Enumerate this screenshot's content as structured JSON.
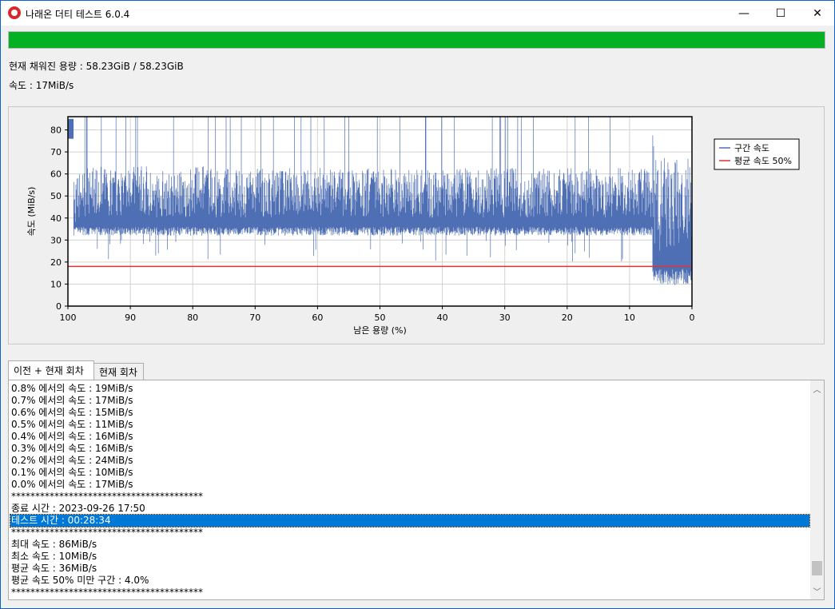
{
  "window": {
    "title": "나래온 더티 테스트 6.0.4",
    "minimize_glyph": "—",
    "maximize_glyph": "☐",
    "close_glyph": "✕"
  },
  "progress": {
    "percent": 100,
    "color": "#06b025"
  },
  "capacity_text": "현재 채워진 용량 : 58.23GiB / 58.23GiB",
  "speed_text": "속도 : 17MiB/s",
  "chart_data": {
    "type": "line",
    "xlabel": "남은 용량 (%)",
    "ylabel": "속도 (MiB/s)",
    "xlim": [
      100,
      0
    ],
    "ylim": [
      0,
      86
    ],
    "x_ticks": [
      "100",
      "90",
      "80",
      "70",
      "60",
      "50",
      "40",
      "30",
      "20",
      "10",
      "0"
    ],
    "y_ticks": [
      "0",
      "10",
      "20",
      "30",
      "40",
      "50",
      "60",
      "70",
      "80"
    ],
    "grid": true,
    "legend_position": "top-right",
    "series": [
      {
        "name": "구간 속도",
        "color": "#4f6fb5",
        "description": "dense interval speed trace",
        "x": [
          100,
          99.5,
          99.1,
          98,
          96,
          94,
          92,
          90,
          88,
          86,
          84,
          82,
          80,
          78,
          76,
          74,
          72,
          70,
          68,
          66,
          64,
          62,
          60,
          58,
          56,
          54,
          52,
          50,
          48,
          46,
          44,
          42,
          40,
          38,
          36,
          34,
          32,
          30,
          28,
          26,
          24,
          22,
          20,
          18,
          16,
          14,
          12,
          10,
          8,
          6.5,
          6,
          5,
          4,
          3,
          2,
          1,
          0
        ],
        "y": [
          80,
          82,
          38,
          42,
          44,
          43,
          42,
          43,
          44,
          42,
          43,
          42,
          43,
          44,
          42,
          43,
          42,
          43,
          42,
          43,
          44,
          42,
          43,
          42,
          43,
          42,
          43,
          42,
          43,
          42,
          43,
          42,
          43,
          42,
          43,
          42,
          43,
          42,
          43,
          42,
          43,
          42,
          43,
          42,
          43,
          42,
          43,
          42,
          43,
          42,
          25,
          22,
          24,
          20,
          26,
          22,
          25
        ]
      },
      {
        "name": "평균 속도 50%",
        "color": "#e03030",
        "x": [
          100,
          0
        ],
        "y": [
          18,
          18
        ]
      }
    ]
  },
  "tabs": [
    "이전 + 현재 회차",
    "현재 회차"
  ],
  "log": [
    {
      "text": "0.8% 에서의 속도 : 19MiB/s"
    },
    {
      "text": "0.7% 에서의 속도 : 17MiB/s"
    },
    {
      "text": "0.6% 에서의 속도 : 15MiB/s"
    },
    {
      "text": "0.5% 에서의 속도 : 11MiB/s"
    },
    {
      "text": "0.4% 에서의 속도 : 16MiB/s"
    },
    {
      "text": "0.3% 에서의 속도 : 16MiB/s"
    },
    {
      "text": "0.2% 에서의 속도 : 24MiB/s"
    },
    {
      "text": "0.1% 에서의 속도 : 10MiB/s"
    },
    {
      "text": "0.0% 에서의 속도 : 17MiB/s"
    },
    {
      "text": "****************************************"
    },
    {
      "text": "종료 시간 : 2023-09-26 17:50"
    },
    {
      "text": "테스트 시간 : 00:28:34",
      "selected": true
    },
    {
      "text": "****************************************"
    },
    {
      "text": "최대 속도 : 86MiB/s"
    },
    {
      "text": "최소 속도 : 10MiB/s"
    },
    {
      "text": "평균 속도 : 36MiB/s"
    },
    {
      "text": "평균 속도 50% 미만 구간 : 4.0%"
    },
    {
      "text": "****************************************"
    }
  ],
  "scroll": {
    "up_glyph": "︿",
    "down_glyph": "﹀",
    "position": 0.96
  }
}
